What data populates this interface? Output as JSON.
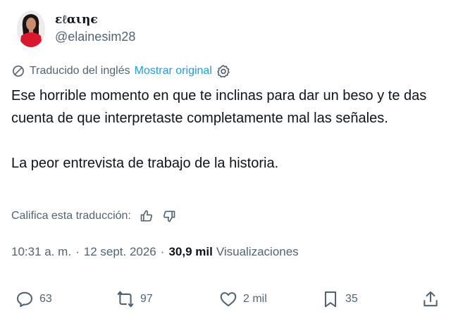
{
  "author": {
    "display_name": "ɛℓαιηє",
    "handle": "@elainesim28"
  },
  "translation": {
    "label": "Traducido del inglés",
    "show_original": "Mostrar original"
  },
  "tweet": {
    "paragraph1": "Ese horrible momento en que te inclinas para dar un beso y te das cuenta de que interpretaste completamente mal las señales.",
    "paragraph2": "La peor entrevista de trabajo de la historia."
  },
  "rate": {
    "label": "Califica esta traducción:"
  },
  "meta": {
    "time": "10:31 a. m.",
    "separator1": "·",
    "date": "12 sept. 2026",
    "separator2": "·",
    "views_count": "30,9 mil",
    "views_label": "Visualizaciones"
  },
  "actions": {
    "replies": "63",
    "retweets": "97",
    "likes": "2 mil",
    "bookmarks": "35"
  },
  "colors": {
    "link": "#1d9bf0",
    "secondary_text": "#536471",
    "primary_text": "#0f1419"
  },
  "icons": {
    "translate": "translate-icon",
    "settings": "gear-icon",
    "thumbs_up": "thumbs-up-icon",
    "thumbs_down": "thumbs-down-icon",
    "reply": "reply-icon",
    "retweet": "retweet-icon",
    "like": "heart-icon",
    "bookmark": "bookmark-icon",
    "share": "share-icon"
  }
}
